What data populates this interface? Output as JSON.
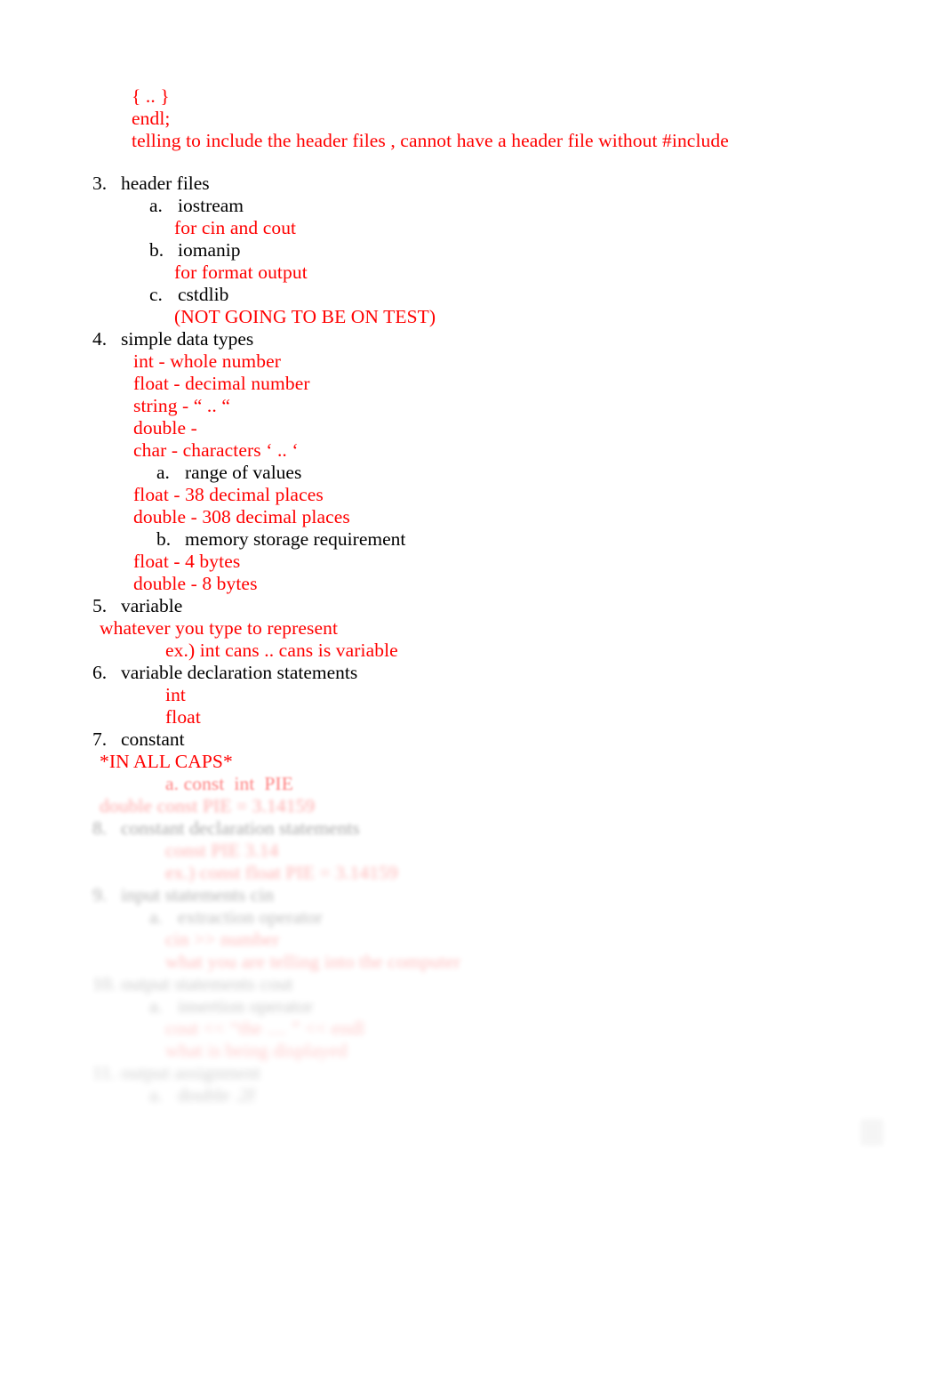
{
  "document": {
    "text_color_default": "#000000",
    "text_color_accent": "#ff0000",
    "background": "#ffffff"
  },
  "top_notes": {
    "line1": "{ .. }",
    "line2": "endl;",
    "line3": "telling to include the header files , cannot have a header file without #include"
  },
  "outline": [
    {
      "marker": "3.",
      "label": "header files",
      "sub": [
        {
          "marker": "a.",
          "label": "iostream",
          "note": "for cin and cout"
        },
        {
          "marker": "b.",
          "label": "iomanip",
          "note": "for format output"
        },
        {
          "marker": "c.",
          "label": "cstdlib",
          "note": "(NOT GOING TO BE ON TEST)"
        }
      ]
    },
    {
      "marker": "4.",
      "label": "simple data types",
      "notes_before": [
        "int - whole number",
        "float - decimal number",
        "string - “ .. “",
        "double -",
        "char - characters ‘ .. ‘"
      ],
      "sub": [
        {
          "marker": "a.",
          "label": "range of values",
          "notes_after": [
            "float - 38 decimal places",
            "double - 308 decimal places"
          ]
        },
        {
          "marker": "b.",
          "label": "memory storage requirement",
          "notes_after": [
            "float - 4 bytes",
            "double - 8 bytes"
          ]
        }
      ]
    },
    {
      "marker": "5.",
      "label": "variable",
      "note_flush": "whatever you type to represent",
      "note_indent": "ex.) int cans .. cans is variable"
    },
    {
      "marker": "6.",
      "label": "variable declaration statements",
      "notes": [
        "int",
        "float"
      ]
    },
    {
      "marker": "7.",
      "label": "constant",
      "note_flush": "*IN ALL CAPS*"
    }
  ],
  "degraded_section": {
    "note": "lower portion of page is blurred/faded and only partially legible",
    "lines": [
      {
        "marker": "",
        "text": "a. const  int  PIE",
        "color": "#ff0000",
        "indent": "a",
        "fade": 1
      },
      {
        "marker": "",
        "text": "double const PIE = 3.14159",
        "color": "#ff0000",
        "indent": "flush",
        "fade": 2
      },
      {
        "marker": "8.",
        "text": "constant declaration statements",
        "color": "#000000",
        "indent": "num",
        "fade": 2
      },
      {
        "marker": "",
        "text": "const PIE 3.14",
        "color": "#ff0000",
        "indent": "red1",
        "fade": 3
      },
      {
        "marker": "",
        "text": "ex.) const float PIE = 3.14159",
        "color": "#ff0000",
        "indent": "red2",
        "fade": 3
      },
      {
        "marker": "9.",
        "text": "input statements cin",
        "color": "#000000",
        "indent": "num",
        "fade": 3
      },
      {
        "marker": "a.",
        "text": "extraction operator",
        "color": "#000000",
        "indent": "a",
        "fade": 4
      },
      {
        "marker": "",
        "text": "cin >> number",
        "color": "#ff0000",
        "indent": "red2",
        "fade": 4
      },
      {
        "marker": "",
        "text": "what you are telling into the computer",
        "color": "#ff0000",
        "indent": "red2",
        "fade": 4
      },
      {
        "marker": "10.",
        "text": "output statements cout",
        "color": "#000000",
        "indent": "num",
        "fade": 5
      },
      {
        "marker": "a.",
        "text": "insertion operator",
        "color": "#000000",
        "indent": "a",
        "fade": 5
      },
      {
        "marker": "",
        "text": "cout << “the .... ” << endl",
        "color": "#ff0000",
        "indent": "red2",
        "fade": 5
      },
      {
        "marker": "",
        "text": "what is being displayed",
        "color": "#ff0000",
        "indent": "red2",
        "fade": 5
      },
      {
        "marker": "11.",
        "text": "output assignment",
        "color": "#000000",
        "indent": "num",
        "fade": 6
      },
      {
        "marker": "a.",
        "text": "double .2f",
        "color": "#000000",
        "indent": "a",
        "fade": 6
      }
    ]
  }
}
